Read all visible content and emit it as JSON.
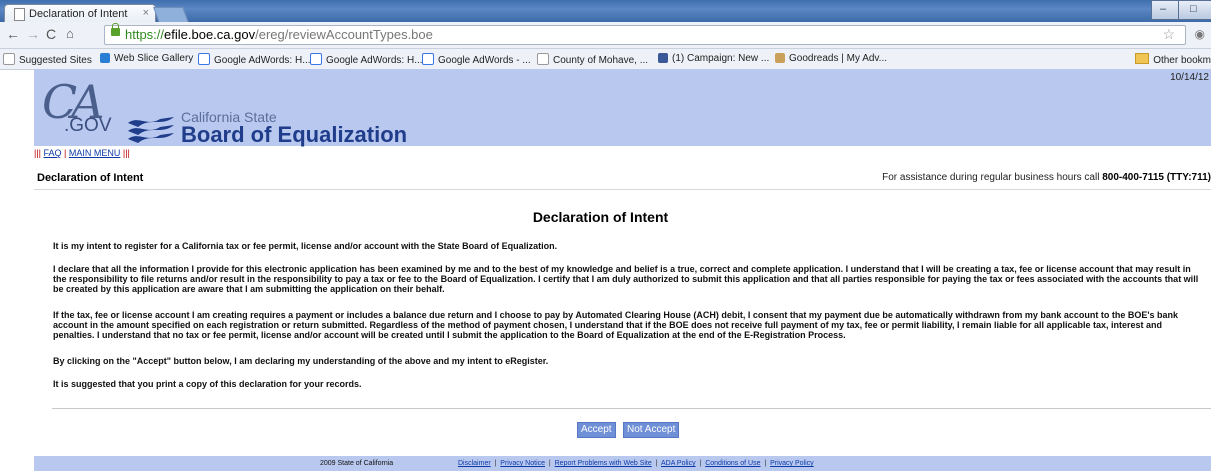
{
  "browser": {
    "tab_title": "Declaration of Intent",
    "tab_close": "×",
    "url_scheme": "https://",
    "url_host": "efile.boe.ca.gov",
    "url_path": "/ereg/reviewAccountTypes.boe",
    "star": "☆",
    "bookmarks": [
      {
        "label": "Suggested Sites",
        "icon": "page-icon"
      },
      {
        "label": "Web Slice Gallery",
        "icon": "ie-icon"
      },
      {
        "label": "Google AdWords: H...",
        "icon": "google-icon"
      },
      {
        "label": "Google AdWords: H...",
        "icon": "google-icon"
      },
      {
        "label": "Google AdWords - ...",
        "icon": "google-icon"
      },
      {
        "label": "County of Mohave, ...",
        "icon": "page-icon"
      },
      {
        "label": "(1) Campaign: New ...",
        "icon": "facebook-icon"
      },
      {
        "label": "Goodreads | My Adv...",
        "icon": "goodreads-icon"
      }
    ],
    "other_bookmarks": "Other bookm"
  },
  "page": {
    "date": "10/14/12",
    "ca_logo": "CA",
    "gov_logo": ".GOV",
    "agency_small": "California State",
    "agency_large": "Board of Equalization",
    "nav_prefix": "||| ",
    "faq": "FAQ",
    "sep": " | ",
    "main_menu": "MAIN MENU",
    "nav_suffix": " |||",
    "header_title": "Declaration of Intent",
    "assist_text": "For assistance during regular business hours call ",
    "assist_phone": "800-400-7115 (TTY:711)",
    "heading": "Declaration of Intent",
    "paragraphs": [
      "It is my intent to register for a California tax or fee permit, license and/or account with the State Board of Equalization.",
      "I declare that all the information I provide for this electronic application has been examined by me and to the best of my knowledge and belief is a true, correct and complete application. I understand that I will be creating a tax, fee or license account that may result in the responsibility to file returns and/or result in the responsibility to pay a tax or fee to the Board of Equalization. I certify that I am duly authorized to submit this application and that all parties responsible for paying the tax or fees associated with the accounts that will be created by this application are aware that I am submitting the application on their behalf.",
      "If the tax, fee or license account I am creating requires a payment or includes a balance due return and I choose to pay by Automated Clearing House (ACH) debit, I consent that my payment due be automatically withdrawn from my bank account to the BOE's bank account in the amount specified on each registration or return submitted. Regardless of the method of payment chosen, I understand that if the BOE does not receive full payment of my tax, fee or permit liability, I remain liable for all applicable tax, interest and penalties. I understand that no tax or fee permit, license and/or account will be created until I submit the application to the Board of Equalization at the end of the E-Registration Process.",
      "By clicking on the \"Accept\" button below, I am declaring my understanding of the above and my intent to eRegister.",
      "It is suggested that you print a copy of this declaration for your records."
    ],
    "accept": "Accept",
    "not_accept": "Not Accept"
  },
  "footer": {
    "year": "2009 State of California",
    "links": [
      "Disclaimer",
      "Privacy Notice",
      "Report Problems with Web Site",
      "ADA Policy",
      "Conditions of Use",
      "Privacy Policy"
    ]
  },
  "colors": {
    "banner": "#b9c8ee",
    "button": "#6f8fd6",
    "link": "#0b3aa8"
  }
}
